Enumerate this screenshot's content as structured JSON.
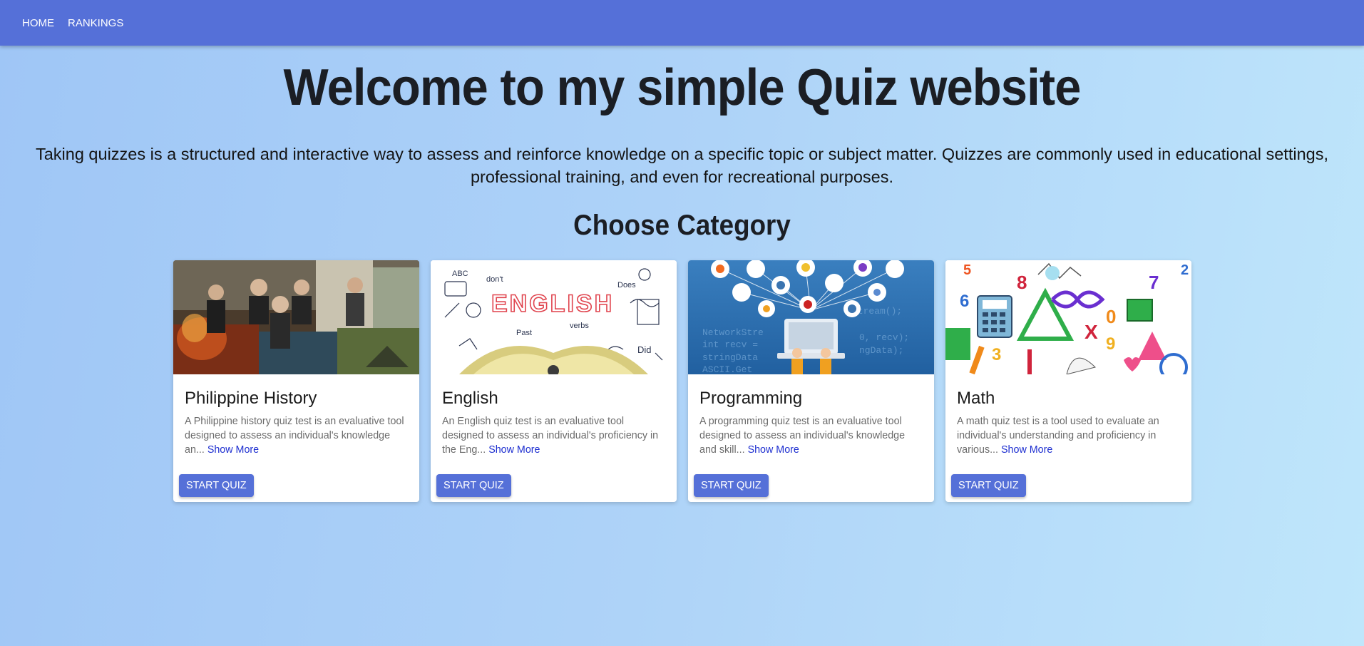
{
  "nav": {
    "home_label": "HOME",
    "rankings_label": "RANKINGS"
  },
  "hero": {
    "title": "Welcome to my simple Quiz website",
    "intro": "Taking quizzes is a structured and interactive way to assess and reinforce knowledge on a specific topic or subject matter. Quizzes are commonly used in educational settings, professional training, and even for recreational purposes."
  },
  "category_heading": "Choose Category",
  "cards": [
    {
      "title": "Philippine History",
      "description": "A Philippine history quiz test is an evaluative tool designed to assess an individual's knowledge an...",
      "show_more": "Show More",
      "button": "START QUIZ",
      "image_text": ""
    },
    {
      "title": "English",
      "description": "An English quiz test is an evaluative tool designed to assess an individual's proficiency in the Eng...",
      "show_more": "Show More",
      "button": "START QUIZ",
      "image_text": "ENGLISH"
    },
    {
      "title": "Programming",
      "description": "A programming quiz test is an evaluative tool designed to assess an individual's knowledge and skill...",
      "show_more": "Show More",
      "button": "START QUIZ",
      "image_text": ""
    },
    {
      "title": "Math",
      "description": "A math quiz test is a tool used to evaluate an individual's understanding and proficiency in various...",
      "show_more": "Show More",
      "button": "START QUIZ",
      "image_text": ""
    }
  ],
  "colors": {
    "primary": "#5570d8",
    "heading": "#1b1e24",
    "link": "#1e2fd0"
  }
}
